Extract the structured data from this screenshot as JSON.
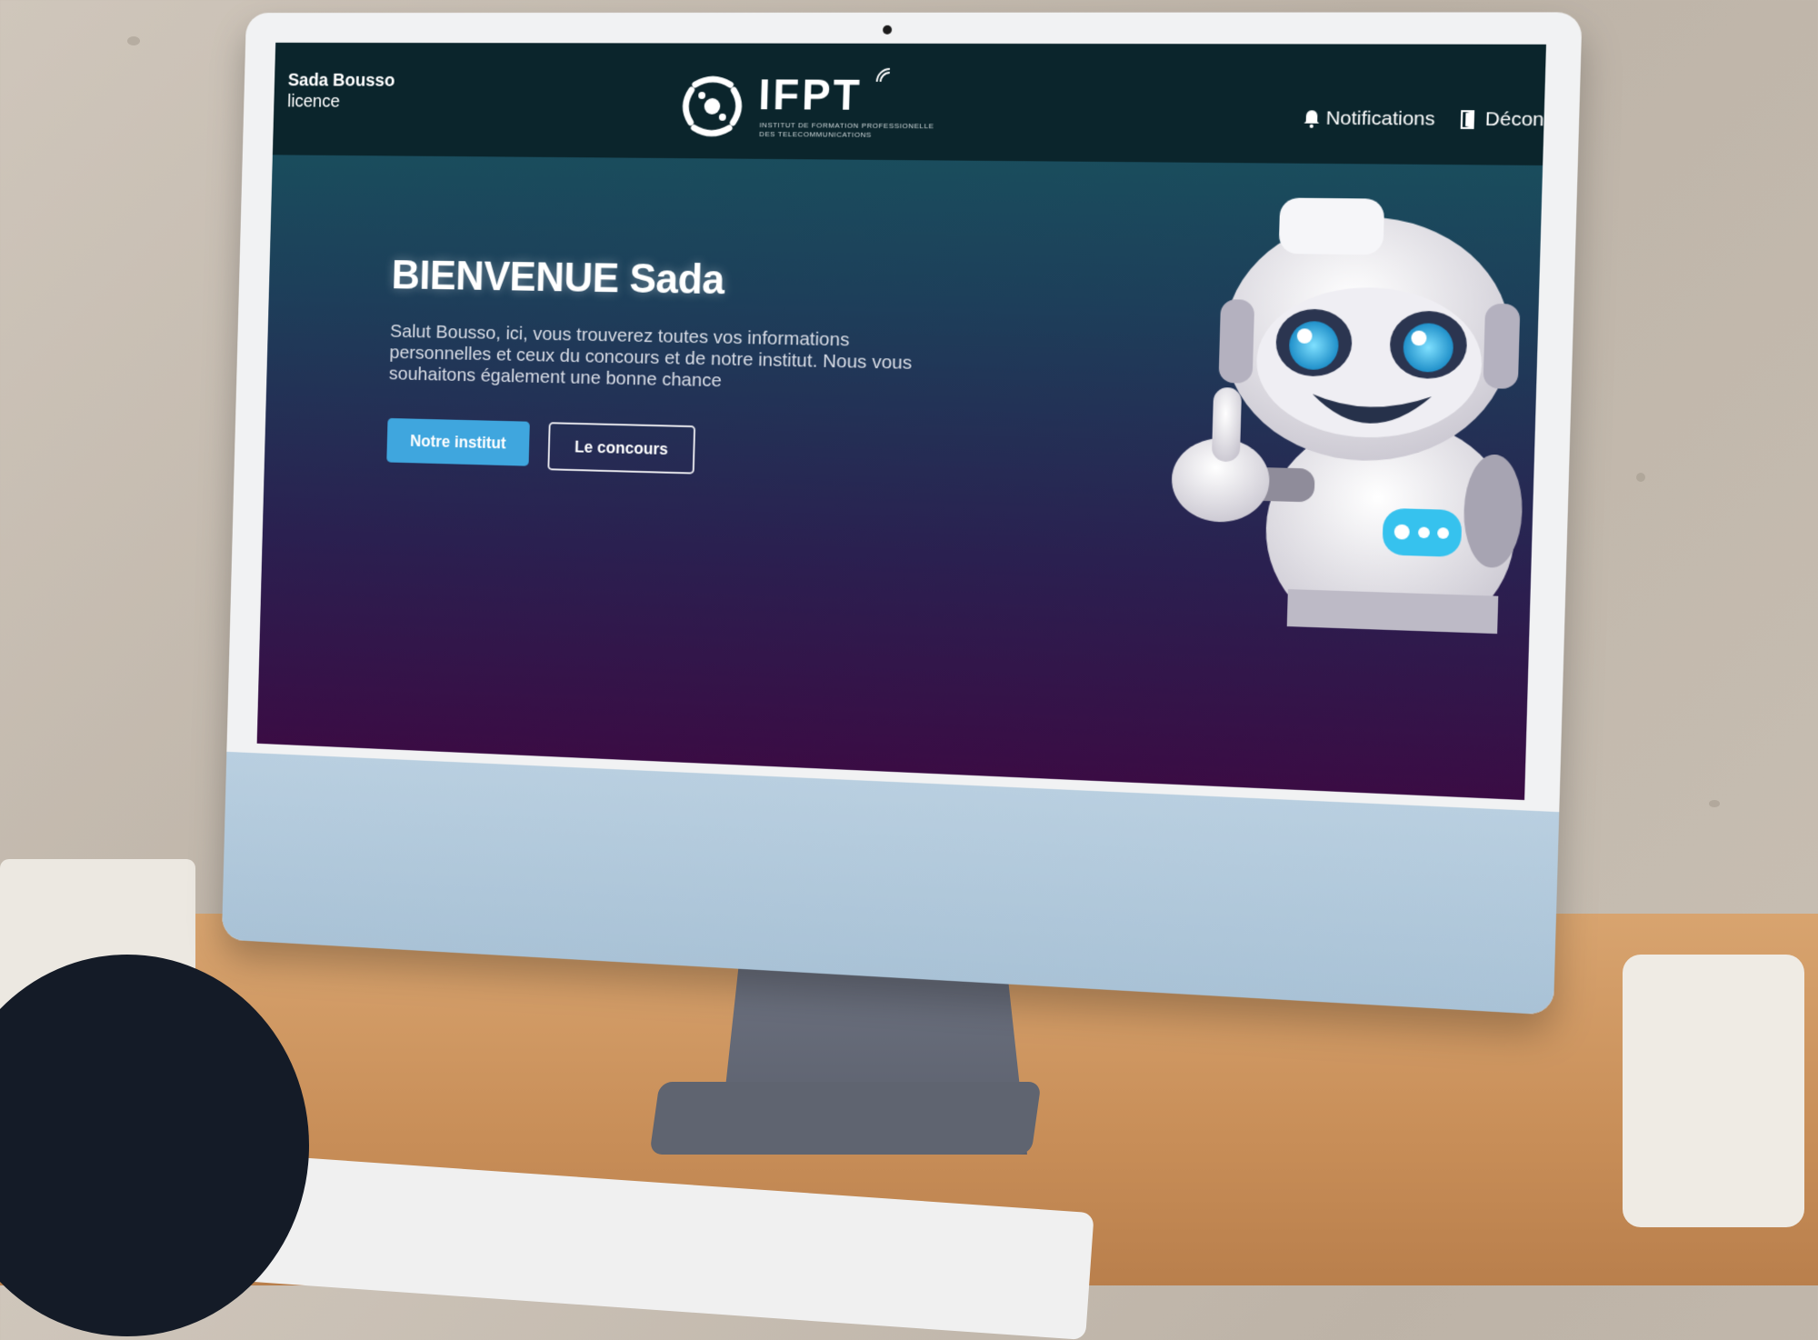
{
  "header": {
    "user_name": "Sada Bousso",
    "user_role": "licence",
    "logo_text": "IFPT",
    "logo_subtitle": "INSTITUT DE FORMATION PROFESSIONELLE DES TELECOMMUNICATIONS",
    "nav": {
      "notifications_label": "Notifications",
      "logout_label": "Décon"
    }
  },
  "hero": {
    "title": "BIENVENUE Sada",
    "text": "Salut Bousso, ici, vous trouverez toutes vos informations personnelles et ceux du concours et de notre institut. Nous vous souhaitons également une bonne chance",
    "buttons": {
      "primary_label": "Notre institut",
      "secondary_label": "Le concours"
    }
  },
  "icons": {
    "notifications": "bell-icon",
    "logout": "door-icon",
    "logo": "ifpt-logo-icon",
    "mascot": "robot-thumbs-up-illustration"
  },
  "colors": {
    "topbar": "#0b252c",
    "primary_button": "#3fa6de",
    "gradient_top": "#17585f",
    "gradient_bottom": "#3a0c44"
  }
}
